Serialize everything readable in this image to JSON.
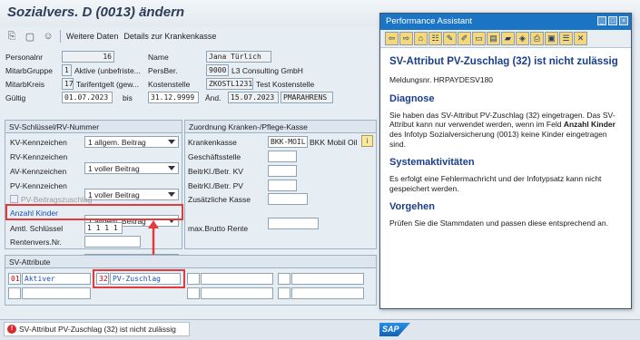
{
  "window_title": "Sozialvers. D (0013) ändern",
  "toolbar": {
    "weitere_daten": "Weitere Daten",
    "details_kk": "Details zur Krankenkasse"
  },
  "header": {
    "personalnr_label": "Personalnr",
    "personalnr": "16",
    "name_label": "Name",
    "name": "Jana Türlich",
    "mitarbgruppe_label": "MitarbGruppe",
    "mitarbgruppe_code": "1",
    "mitarbgruppe_text": "Aktive (unbefriste...",
    "persber_label": "PersBer.",
    "persber_code": "9000",
    "persber_text": "L3 Consulting GmbH",
    "mitarbkreis_label": "MitarbKreis",
    "mitarbkreis_code": "17",
    "mitarbkreis_text": "Tarifentgelt (gew...",
    "kostenstelle_label": "Kostenstelle",
    "kostenstelle_code": "ZKOSTL1231",
    "kostenstelle_text": "Test Kostenstelle",
    "gueltig_label": "Gültig",
    "gueltig_from": "01.07.2023",
    "bis_label": "bis",
    "gueltig_to": "31.12.9999",
    "aend_label": "Änd.",
    "aend_date": "15.07.2023",
    "aend_user": "PMARAHRENS"
  },
  "sv_group": {
    "title": "SV-Schlüssel/RV-Nummer",
    "rows": [
      {
        "label": "KV-Kennzeichen",
        "value": "1 allgem. Beitrag"
      },
      {
        "label": "RV-Kennzeichen",
        "value": "1 voller Beitrag"
      },
      {
        "label": "AV-Kennzeichen",
        "value": "1 voller Beitrag"
      },
      {
        "label": "PV-Kennzeichen",
        "value": "1 allgem. Beitrag"
      }
    ],
    "pv_zuschlag_label": "PV-Beitragszuschlag",
    "anzahl_kinder_label": "Anzahl Kinder",
    "anzahl_kinder": "1",
    "amtl_schluessel_label": "Amtl. Schlüssel",
    "amtl_schluessel": "1 1 1 1",
    "rentenvers_label": "Rentenvers.Nr.",
    "rentenvers": ""
  },
  "kk_group": {
    "title": "Zuordnung Kranken-/Pflege-Kasse",
    "krankenkasse_label": "Krankenkasse",
    "krankenkasse_code": "BKK-MOIL",
    "krankenkasse_text": "BKK Mobil Oil",
    "geschaeftsstelle_label": "Geschäftsstelle",
    "beitrkl_kv_label": "BeitrKl./Betr. KV",
    "beitrkl_pv_label": "BeitrKl./Betr. PV",
    "zus_kasse_label": "Zusätzliche Kasse",
    "max_brutto_label": "max.Brutto Rente"
  },
  "attr_group": {
    "title": "SV-Attribute",
    "attr1_code": "01",
    "attr1_text": "Aktiver",
    "attr2_code": "32",
    "attr2_text": "PV-Zuschlag"
  },
  "pa": {
    "title": "Performance Assistant",
    "heading": "SV-Attribut PV-Zuschlag (32) ist nicht zulässig",
    "msgnr": "Meldungsnr. HRPAYDESV180",
    "diagnose_h": "Diagnose",
    "diagnose_p1": "Sie haben das SV-Attribut PV-Zuschlag (32) eingetragen. Das SV-Attribut kann nur verwendet werden, wenn im Feld ",
    "diagnose_bold": "Anzahl Kinder",
    "diagnose_p2": " des Infotyp Sozialversicherung (0013) keine Kinder eingetragen sind.",
    "sys_h": "Systemaktivitäten",
    "sys_p": "Es erfolgt eine Fehlermachricht und der Infotypsatz kann nicht gespeichert werden.",
    "vorg_h": "Vorgehen",
    "vorg_p": "Prüfen Sie die Stammdaten und passen diese entsprechend an."
  },
  "status": {
    "message": "SV-Attribut PV-Zuschlag (32) ist nicht zulässig",
    "logo": "SAP"
  },
  "colors": {
    "accent": "#1b75c4",
    "highlight": "#e23b3b"
  }
}
